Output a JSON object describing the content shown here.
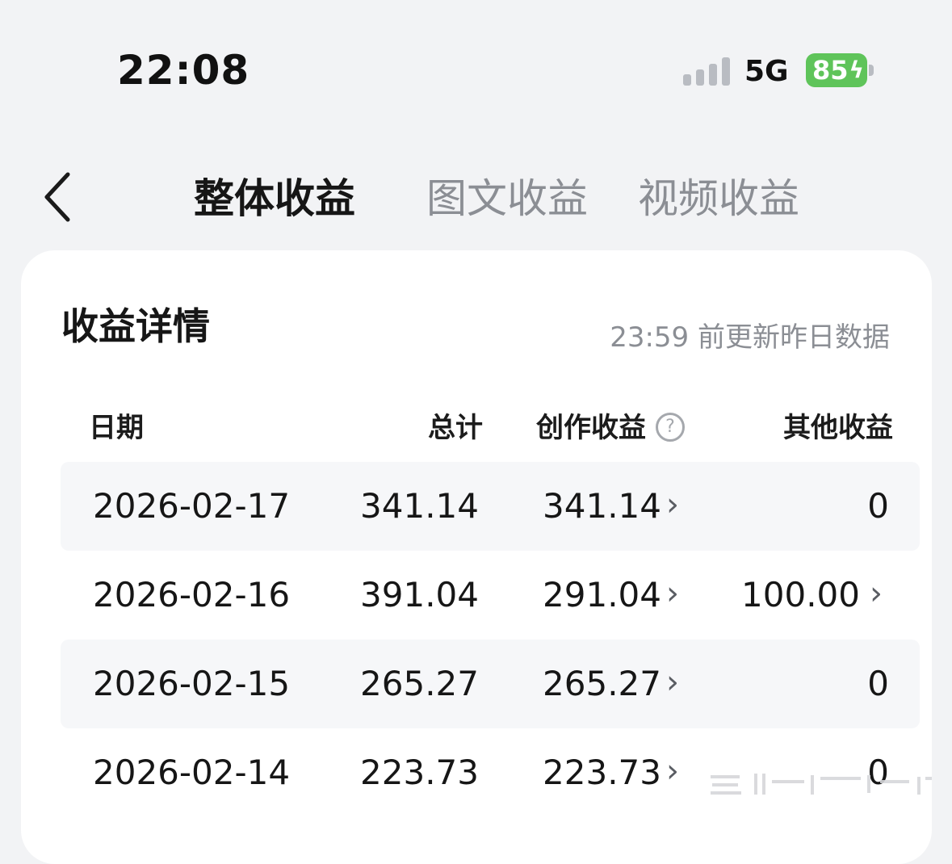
{
  "status_bar": {
    "time": "22:08",
    "network": "5G",
    "battery": "85",
    "battery_color": "#5fc45a"
  },
  "nav": {
    "back_icon": "chevron-left-icon",
    "tabs": [
      {
        "label": "整体收益",
        "active": true
      },
      {
        "label": "图文收益",
        "active": false
      },
      {
        "label": "视频收益",
        "active": false
      }
    ]
  },
  "card": {
    "title": "收益详情",
    "update_note": "23:59 前更新昨日数据",
    "headers": {
      "date": "日期",
      "total": "总计",
      "creation": "创作收益",
      "other": "其他收益"
    },
    "rows": [
      {
        "date": "2026-02-17",
        "total": "341.14",
        "creation": "341.14",
        "other": "0"
      },
      {
        "date": "2026-02-16",
        "total": "391.04",
        "creation": "291.04",
        "other": "100.00"
      },
      {
        "date": "2026-02-15",
        "total": "265.27",
        "creation": "265.27",
        "other": "0"
      },
      {
        "date": "2026-02-14",
        "total": "223.73",
        "creation": "223.73",
        "other": "0"
      }
    ]
  }
}
